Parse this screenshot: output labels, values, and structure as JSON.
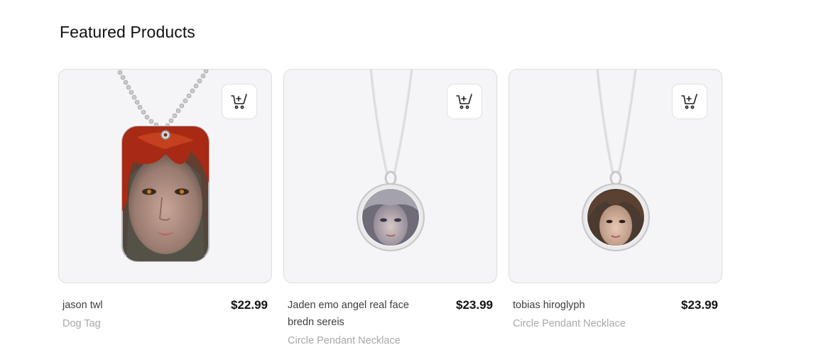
{
  "section": {
    "title": "Featured Products"
  },
  "products": [
    {
      "name": "jason twl",
      "category": "Dog Tag",
      "price": "$22.99",
      "image_icon": "dog-tag-pendant-image",
      "cart_icon": "add-to-cart-icon"
    },
    {
      "name": "Jaden emo angel real face bredn sereis",
      "category": "Circle Pendant Necklace",
      "price": "$23.99",
      "image_icon": "circle-pendant-image",
      "cart_icon": "add-to-cart-icon"
    },
    {
      "name": "tobias hiroglyph",
      "category": "Circle Pendant Necklace",
      "price": "$23.99",
      "image_icon": "circle-pendant-image",
      "cart_icon": "add-to-cart-icon"
    }
  ],
  "colors": {
    "card_bg": "#f5f5f7",
    "card_border": "#dcdcdf",
    "muted_text": "#a8a8a8",
    "hair_red": "#a82a14"
  }
}
